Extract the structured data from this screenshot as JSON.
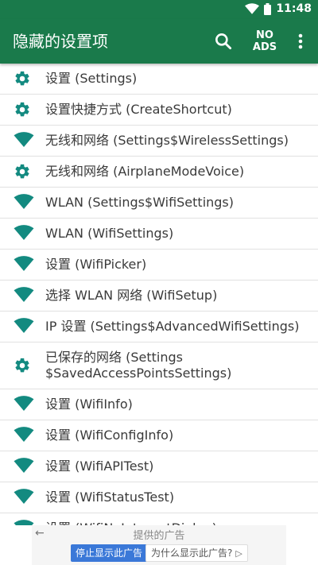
{
  "status_bar": {
    "time": "11:48"
  },
  "toolbar": {
    "title": "隐藏的设置项",
    "noads_line1": "NO",
    "noads_line2": "ADS",
    "accent": "#1a7a4b"
  },
  "list": {
    "icon_color": "#138a80",
    "items": [
      {
        "icon": "gear-icon",
        "label": "设置 (Settings)"
      },
      {
        "icon": "gear-icon",
        "label": "设置快捷方式 (CreateShortcut)"
      },
      {
        "icon": "wifi-icon",
        "label": "无线和网络 (Settings$WirelessSettings)"
      },
      {
        "icon": "gear-icon",
        "label": "无线和网络 (AirplaneModeVoice)"
      },
      {
        "icon": "wifi-icon",
        "label": "WLAN (Settings$WifiSettings)"
      },
      {
        "icon": "wifi-icon",
        "label": "WLAN (WifiSettings)"
      },
      {
        "icon": "wifi-icon",
        "label": "设置 (WifiPicker)"
      },
      {
        "icon": "wifi-icon",
        "label": "选择 WLAN 网络 (WifiSetup)"
      },
      {
        "icon": "wifi-icon",
        "label": "IP 设置 (Settings$AdvancedWifiSettings)"
      },
      {
        "icon": "gear-icon",
        "label": "已保存的网络 (Settings $SavedAccessPointsSettings)"
      },
      {
        "icon": "wifi-icon",
        "label": "设置 (WifiInfo)"
      },
      {
        "icon": "wifi-icon",
        "label": "设置 (WifiConfigInfo)"
      },
      {
        "icon": "wifi-icon",
        "label": "设置 (WifiAPITest)"
      },
      {
        "icon": "wifi-icon",
        "label": "设置 (WifiStatusTest)"
      },
      {
        "icon": "wifi-icon",
        "label": "设置 (WifiNoInternetDialog)"
      }
    ]
  },
  "ad": {
    "title": "提供的广告",
    "stop_label": "停止显示此广告",
    "why_label": "为什么显示此广告?"
  }
}
